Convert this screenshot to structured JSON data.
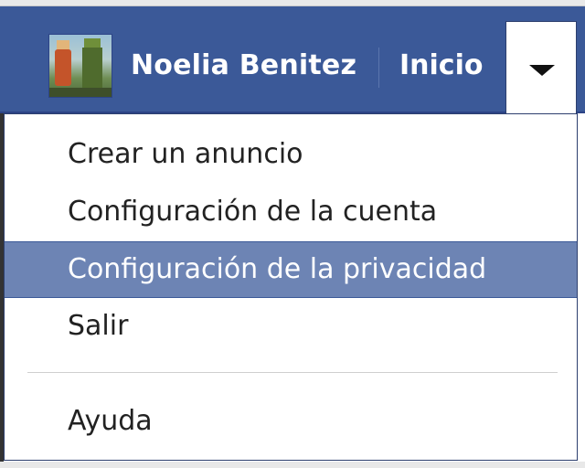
{
  "header": {
    "user_name": "Noelia Benitez",
    "home_label": "Inicio",
    "avatar_icon": "user-avatar",
    "dropdown_icon": "caret-down-icon",
    "background_color": "#3b5998"
  },
  "menu": {
    "items": [
      {
        "label": "Crear un anuncio"
      },
      {
        "label": "Configuración de la cuenta"
      },
      {
        "label": "Configuración de la privacidad",
        "selected": true
      },
      {
        "label": "Salir"
      },
      {
        "label": "Ayuda"
      }
    ],
    "highlight_color": "#6d84b4"
  }
}
